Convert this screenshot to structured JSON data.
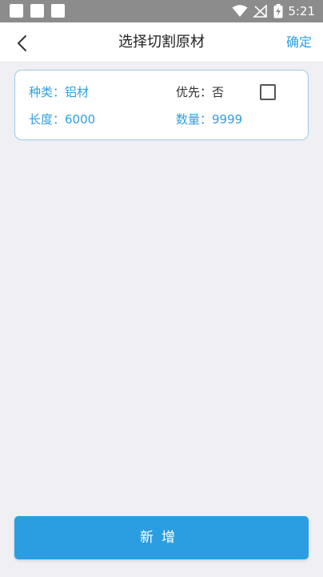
{
  "status_bar": {
    "time": "5:21",
    "icons": [
      "wifi-icon",
      "no-signal-icon",
      "battery-charging-icon"
    ]
  },
  "nav": {
    "title": "选择切割原材",
    "confirm_label": "确定",
    "back_icon": "chevron-left-icon"
  },
  "material_card": {
    "type_label": "种类：",
    "type_value": "铝材",
    "priority_label": "优先：",
    "priority_value": "否",
    "priority_checked": false,
    "length_label": "长度：",
    "length_value": "6000",
    "quantity_label": "数量：",
    "quantity_value": "9999"
  },
  "add_button_label": "新增",
  "colors": {
    "accent": "#2e9fde",
    "button": "#2a9ee0",
    "background": "#efeff4",
    "status_bar": "#8c8c8c"
  }
}
